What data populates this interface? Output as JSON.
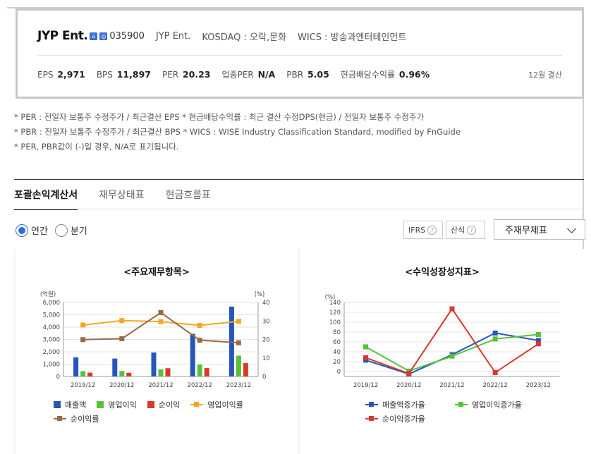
{
  "summary": {
    "name": "JYP Ent.",
    "icons": [
      "home-icon",
      "ir-icon"
    ],
    "code": "035900",
    "eng_name": "JYP Ent.",
    "market": "KOSDAQ : 오락,문화",
    "wics": "WICS : 방송과엔터테인먼트",
    "metrics": [
      {
        "label": "EPS",
        "value": "2,971"
      },
      {
        "label": "BPS",
        "value": "11,897"
      },
      {
        "label": "PER",
        "value": "20.23"
      },
      {
        "label": "업종PER",
        "value": "N/A"
      },
      {
        "label": "PBR",
        "value": "5.05"
      },
      {
        "label": "현금배당수익률",
        "value": "0.96%"
      }
    ],
    "settlement": "12월 결산"
  },
  "notes": [
    "* PER : 전일자 보통주 수정주가 / 최근결산 EPS * 현금배당수익률 : 최근 결산 수정DPS(현금) / 전일자 보통주 수정주가",
    "* PBR : 전일자 보통주 수정주가 / 최근결산 BPS * WICS : WISE Industry Classification Standard, modified by FnGuide",
    "* PER, PBR값이 (-)일 경우, N/A로 표기됩니다."
  ],
  "tabs": [
    "포괄손익계산서",
    "재무상태표",
    "현금흐름표"
  ],
  "period": {
    "annual": "연간",
    "quarter": "분기"
  },
  "buttons": {
    "ifrs": "IFRS",
    "formula": "산식",
    "help": "?"
  },
  "statement_select": "주재무제표",
  "colors": {
    "revenue": "#2656b8",
    "op_income": "#55c238",
    "net_income": "#d8392a",
    "op_margin": "#f5a623",
    "net_margin": "#9a6a44",
    "rev_growth": "#2656b8",
    "op_growth": "#55c238",
    "net_growth": "#d8392a"
  },
  "chart_data": [
    {
      "type": "bar",
      "title": "<주요재무항목>",
      "categories": [
        "2019/12",
        "2020/12",
        "2021/12",
        "2022/12",
        "2023/12"
      ],
      "ylabel": "(억원)",
      "y2label": "(%)",
      "ylim": [
        0,
        6000
      ],
      "y2lim": [
        0,
        40
      ],
      "yticks": [
        "0",
        "1,000",
        "2,000",
        "3,000",
        "4,000",
        "5,000",
        "6,000"
      ],
      "y2ticks": [
        "0",
        "10",
        "20",
        "30",
        "40"
      ],
      "series": [
        {
          "name": "매출액",
          "kind": "bar",
          "axis": "left",
          "values": [
            1550,
            1450,
            1940,
            3460,
            5660
          ]
        },
        {
          "name": "영업이익",
          "kind": "bar",
          "axis": "left",
          "values": [
            430,
            440,
            580,
            960,
            1690
          ]
        },
        {
          "name": "순이익",
          "kind": "bar",
          "axis": "left",
          "values": [
            310,
            300,
            670,
            680,
            1080
          ]
        },
        {
          "name": "영업이익률",
          "kind": "line",
          "axis": "right",
          "values": [
            27.8,
            30.2,
            29.6,
            27.6,
            29.8
          ]
        },
        {
          "name": "순이익률",
          "kind": "line",
          "axis": "right",
          "values": [
            19.9,
            20.4,
            34.5,
            19.6,
            18.2
          ]
        }
      ],
      "grid": true,
      "legend": "bottom"
    },
    {
      "type": "line",
      "title": "<수익성장성지표>",
      "categories": [
        "2019/12",
        "2020/12",
        "2021/12",
        "2022/12",
        "2023/12"
      ],
      "ylabel": "(%)",
      "ylim": [
        -10,
        140
      ],
      "yticks": [
        "0",
        "20",
        "40",
        "60",
        "80",
        "100",
        "120",
        "140"
      ],
      "series": [
        {
          "name": "매출액증가율",
          "values": [
            23,
            -5,
            34,
            78,
            63
          ]
        },
        {
          "name": "영업이익증가율",
          "values": [
            50,
            1,
            31,
            66,
            75
          ]
        },
        {
          "name": "순이익증가율",
          "values": [
            28,
            -4,
            127,
            -2,
            56
          ]
        }
      ],
      "grid": true,
      "legend": "bottom"
    }
  ]
}
